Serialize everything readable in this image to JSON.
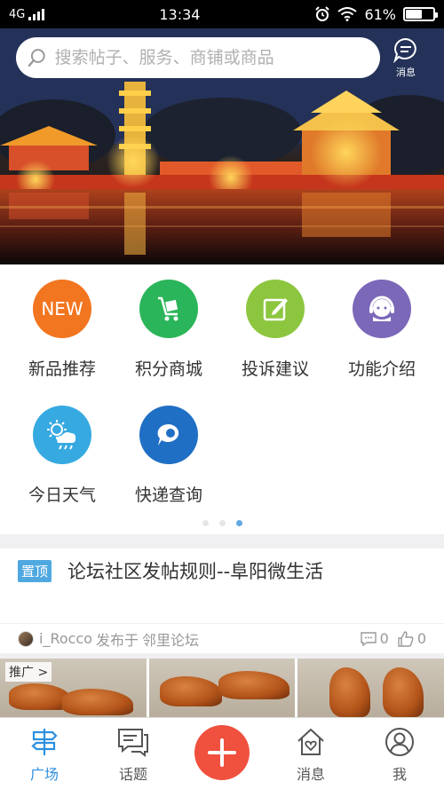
{
  "status_bar": {
    "network": "4G",
    "time": "13:34",
    "battery": "61%",
    "battery_level": 0.61
  },
  "search": {
    "placeholder": "搜索帖子、服务、商铺或商品",
    "message_label": "消息"
  },
  "grid": {
    "items": [
      {
        "label": "新品推荐",
        "icon_text": "NEW",
        "icon": "new-icon",
        "color": "#f2751f"
      },
      {
        "label": "积分商城",
        "icon": "cart-icon",
        "color": "#2bb55a"
      },
      {
        "label": "投诉建议",
        "icon": "edit-icon",
        "color": "#8cc63f"
      },
      {
        "label": "功能介绍",
        "icon": "support-icon",
        "color": "#7b68b8"
      },
      {
        "label": "今日天气",
        "icon": "weather-icon",
        "color": "#36a9e1"
      },
      {
        "label": "快递查询",
        "icon": "chat-bubble-icon",
        "color": "#1f6fc4"
      }
    ],
    "page_count": 3,
    "active_page": 3
  },
  "post": {
    "badge": "置顶",
    "title": "论坛社区发帖规则--阜阳微生活",
    "author": "i_Rocco",
    "posted_in": "发布于",
    "forum": "邻里论坛",
    "comments": "0",
    "likes": "0"
  },
  "promo": {
    "tag": "推广 >"
  },
  "bottom_nav": {
    "items": [
      {
        "label": "广场",
        "icon": "plaza-icon",
        "active": true
      },
      {
        "label": "话题",
        "icon": "topic-icon",
        "active": false
      },
      {
        "label": "",
        "icon": "plus-icon",
        "active": false
      },
      {
        "label": "消息",
        "icon": "home-heart-icon",
        "active": false
      },
      {
        "label": "我",
        "icon": "profile-icon",
        "active": false
      }
    ]
  },
  "colors": {
    "accent": "#2d8fe0",
    "plus": "#f0503e",
    "badge": "#4fa8e0"
  }
}
